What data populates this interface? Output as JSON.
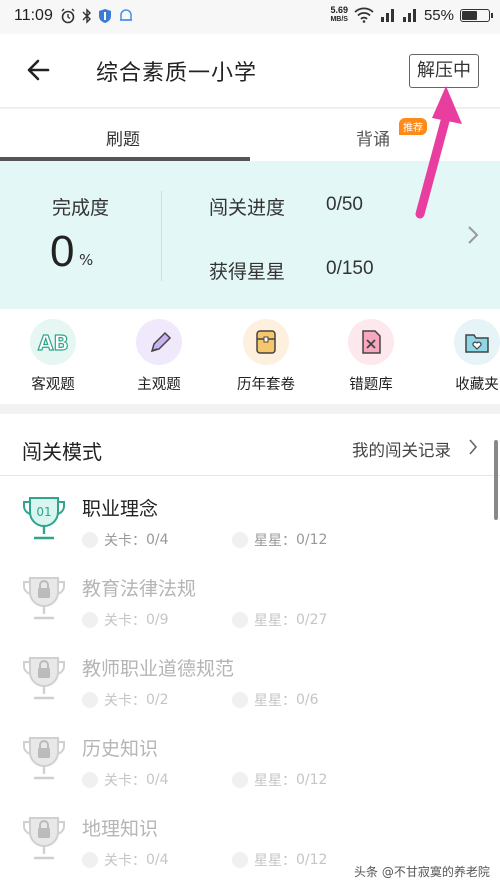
{
  "status_bar": {
    "time": "11:09",
    "net_speed_value": "5.69",
    "net_speed_unit": "MB/S",
    "battery": "55%",
    "battery_level": 0.55
  },
  "header": {
    "title": "综合素质一小学",
    "unzip_button": "解压中"
  },
  "tabs": {
    "items": [
      {
        "label": "刷题",
        "active": true
      },
      {
        "label": "背诵",
        "active": false,
        "badge": "推荐"
      }
    ]
  },
  "progress": {
    "completion_label": "完成度",
    "completion_value": "0",
    "completion_unit": "%",
    "level_progress_label": "闯关进度",
    "level_progress_value": "0/50",
    "stars_label": "获得星星",
    "stars_value": "0/150"
  },
  "quick_actions": [
    {
      "label": "客观题",
      "icon": "ab-icon",
      "color": "#e6f6f2"
    },
    {
      "label": "主观题",
      "icon": "pencil-icon",
      "color": "#efe9fb"
    },
    {
      "label": "历年套卷",
      "icon": "envelope-icon",
      "color": "#fdf0df"
    },
    {
      "label": "错题库",
      "icon": "wrong-doc-icon",
      "color": "#fde8ee"
    },
    {
      "label": "收藏夹",
      "icon": "heart-folder-icon",
      "color": "#e6f4f8"
    }
  ],
  "mode": {
    "title": "闯关模式",
    "record_link": "我的闯关记录",
    "levels": [
      {
        "name": "职业理念",
        "stage_label": "关卡：",
        "stage_value": "0/4",
        "star_label": "星星：",
        "star_value": "0/12",
        "locked": false,
        "badge": "01"
      },
      {
        "name": "教育法律法规",
        "stage_label": "关卡：",
        "stage_value": "0/9",
        "star_label": "星星：",
        "star_value": "0/27",
        "locked": true
      },
      {
        "name": "教师职业道德规范",
        "stage_label": "关卡：",
        "stage_value": "0/2",
        "star_label": "星星：",
        "star_value": "0/6",
        "locked": true
      },
      {
        "name": "历史知识",
        "stage_label": "关卡：",
        "stage_value": "0/4",
        "star_label": "星星：",
        "star_value": "0/12",
        "locked": true
      },
      {
        "name": "地理知识",
        "stage_label": "关卡：",
        "stage_value": "0/4",
        "star_label": "星星：",
        "star_value": "0/12",
        "locked": true
      }
    ]
  },
  "watermark": "头条 @不甘寂寞的养老院",
  "colors": {
    "accent_teal": "#3cc4b0",
    "progress_bg": "#e4f7f7",
    "annotation_arrow": "#e83e9f",
    "badge_orange": "#ff8a1c"
  }
}
